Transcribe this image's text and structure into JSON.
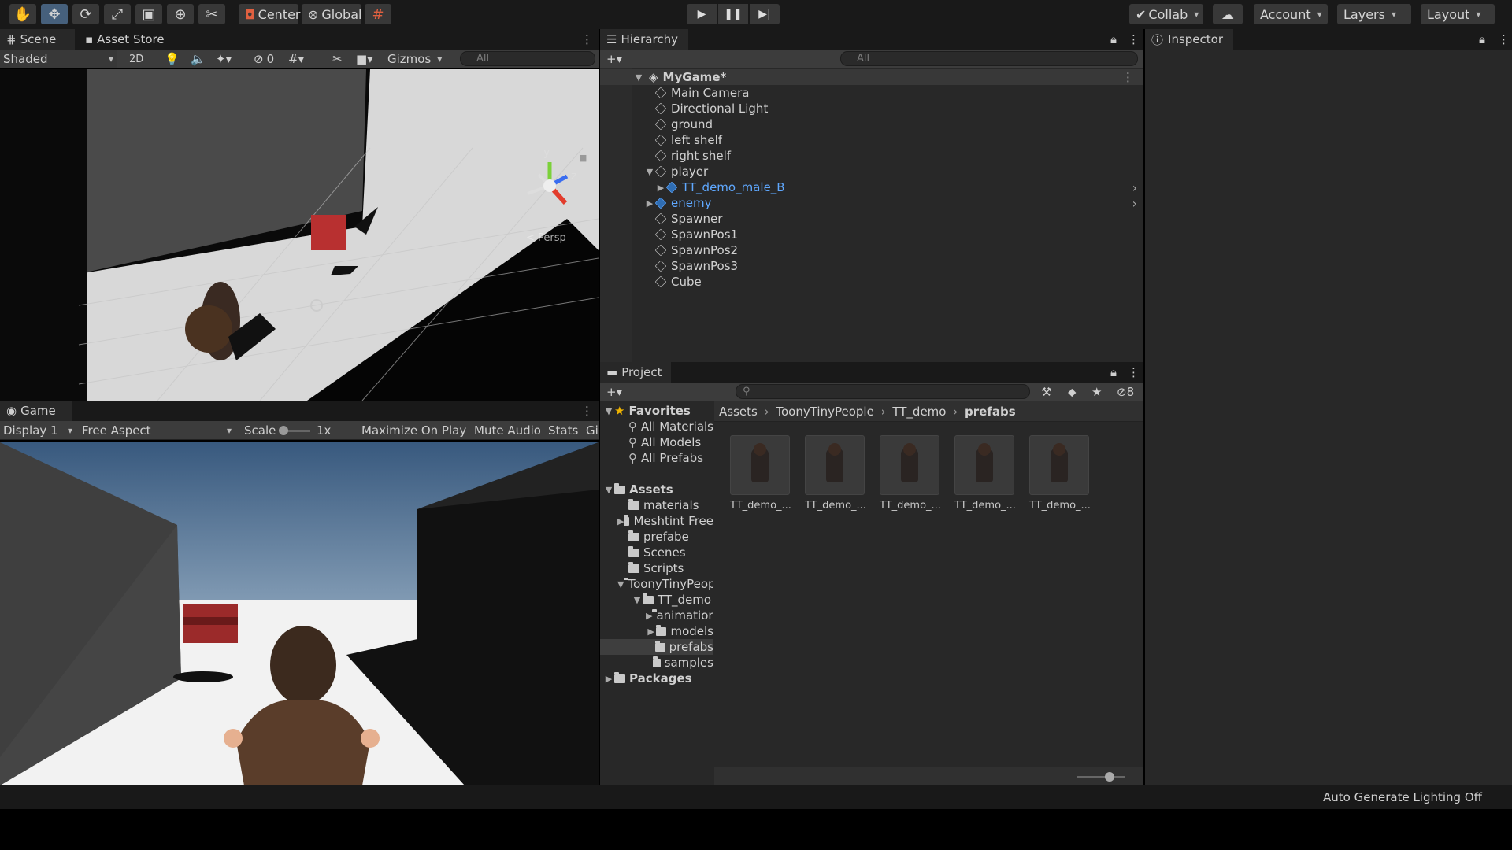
{
  "toolbar": {
    "pivot": "Center",
    "space": "Global",
    "collab": "Collab",
    "account": "Account",
    "layers": "Layers",
    "layout": "Layout"
  },
  "scene": {
    "tab_scene": "Scene",
    "tab_asset_store": "Asset Store",
    "shading_mode": "Shaded",
    "mode_2d": "2D",
    "hidden_count": "0",
    "gizmos": "Gizmos",
    "search_placeholder": "All",
    "axis_y": "y",
    "axis_z": "z",
    "persp": "< Persp"
  },
  "game": {
    "tab": "Game",
    "display": "Display 1",
    "aspect": "Free Aspect",
    "scale_label": "Scale",
    "scale_value": "1x",
    "maximize": "Maximize On Play",
    "mute": "Mute Audio",
    "stats": "Stats",
    "gizmos_short": "Gi"
  },
  "hierarchy": {
    "tab": "Hierarchy",
    "search_placeholder": "All",
    "scene_name": "MyGame*",
    "items": [
      {
        "label": "Main Camera",
        "depth": 1,
        "prefab": false,
        "arrow": ""
      },
      {
        "label": "Directional Light",
        "depth": 1,
        "prefab": false,
        "arrow": ""
      },
      {
        "label": "ground",
        "depth": 1,
        "prefab": false,
        "arrow": ""
      },
      {
        "label": "left shelf",
        "depth": 1,
        "prefab": false,
        "arrow": ""
      },
      {
        "label": "right shelf",
        "depth": 1,
        "prefab": false,
        "arrow": ""
      },
      {
        "label": "player",
        "depth": 1,
        "prefab": false,
        "arrow": "open"
      },
      {
        "label": "TT_demo_male_B",
        "depth": 2,
        "prefab": true,
        "arrow": "closed"
      },
      {
        "label": "enemy",
        "depth": 1,
        "prefab": true,
        "arrow": "closed"
      },
      {
        "label": "Spawner",
        "depth": 1,
        "prefab": false,
        "arrow": ""
      },
      {
        "label": "SpawnPos1",
        "depth": 1,
        "prefab": false,
        "arrow": ""
      },
      {
        "label": "SpawnPos2",
        "depth": 1,
        "prefab": false,
        "arrow": ""
      },
      {
        "label": "SpawnPos3",
        "depth": 1,
        "prefab": false,
        "arrow": ""
      },
      {
        "label": "Cube",
        "depth": 1,
        "prefab": false,
        "arrow": ""
      }
    ]
  },
  "inspector": {
    "tab": "Inspector"
  },
  "project": {
    "tab": "Project",
    "hidden_count": "8",
    "breadcrumb": [
      "Assets",
      "ToonyTinyPeople",
      "TT_demo",
      "prefabs"
    ],
    "tree": [
      {
        "label": "Favorites",
        "depth": 0,
        "kind": "star",
        "arrow": "open",
        "bold": true
      },
      {
        "label": "All Materials",
        "depth": 1,
        "kind": "search",
        "arrow": "",
        "bold": false
      },
      {
        "label": "All Models",
        "depth": 1,
        "kind": "search",
        "arrow": "",
        "bold": false
      },
      {
        "label": "All Prefabs",
        "depth": 1,
        "kind": "search",
        "arrow": "",
        "bold": false
      },
      {
        "label": "",
        "depth": 0,
        "kind": "gap",
        "arrow": "",
        "bold": false
      },
      {
        "label": "Assets",
        "depth": 0,
        "kind": "folder",
        "arrow": "open",
        "bold": true
      },
      {
        "label": "materials",
        "depth": 1,
        "kind": "folder",
        "arrow": "",
        "bold": false
      },
      {
        "label": "Meshtint Free",
        "depth": 1,
        "kind": "folder",
        "arrow": "closed",
        "bold": false
      },
      {
        "label": "prefabe",
        "depth": 1,
        "kind": "folder",
        "arrow": "",
        "bold": false
      },
      {
        "label": "Scenes",
        "depth": 1,
        "kind": "folder",
        "arrow": "",
        "bold": false
      },
      {
        "label": "Scripts",
        "depth": 1,
        "kind": "folder",
        "arrow": "",
        "bold": false
      },
      {
        "label": "ToonyTinyPeople",
        "depth": 1,
        "kind": "folder",
        "arrow": "open",
        "bold": false
      },
      {
        "label": "TT_demo",
        "depth": 2,
        "kind": "folder",
        "arrow": "open",
        "bold": false
      },
      {
        "label": "animation",
        "depth": 3,
        "kind": "folder",
        "arrow": "closed",
        "bold": false
      },
      {
        "label": "models",
        "depth": 3,
        "kind": "folder",
        "arrow": "closed",
        "bold": false
      },
      {
        "label": "prefabs",
        "depth": 3,
        "kind": "folder",
        "arrow": "",
        "bold": false,
        "selected": true
      },
      {
        "label": "samples",
        "depth": 3,
        "kind": "folder",
        "arrow": "",
        "bold": false
      },
      {
        "label": "Packages",
        "depth": 0,
        "kind": "folder",
        "arrow": "closed",
        "bold": true
      }
    ],
    "assets": [
      "TT_demo_...",
      "TT_demo_...",
      "TT_demo_...",
      "TT_demo_...",
      "TT_demo_..."
    ]
  },
  "status": {
    "lighting": "Auto Generate Lighting Off"
  },
  "colors": {
    "accent": "#46607c",
    "prefab_blue": "#5fa8ff",
    "panel": "#282828",
    "header": "#191919"
  }
}
